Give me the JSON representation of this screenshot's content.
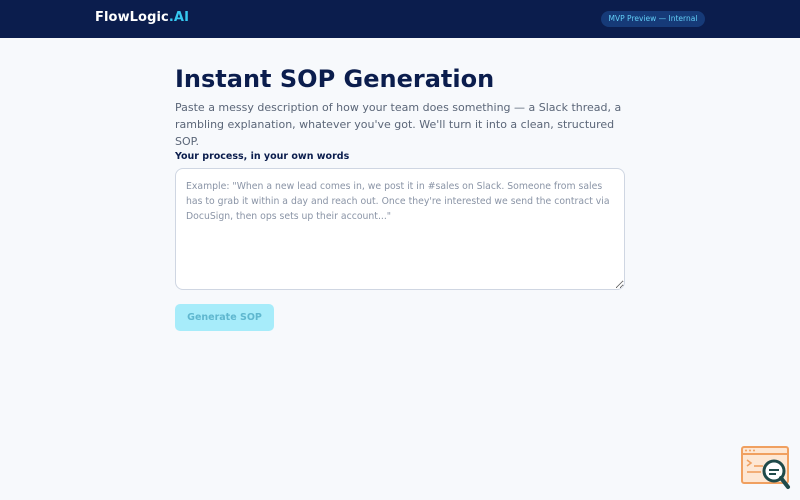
{
  "header": {
    "logo_main": "FlowLogic",
    "logo_accent": ".AI",
    "badge": "MVP Preview — Internal"
  },
  "main": {
    "title": "Instant SOP Generation",
    "subtitle": "Paste a messy description of how your team does something — a Slack thread, a rambling explanation, whatever you've got. We'll turn it into a clean, structured SOP.",
    "field_label": "Your process, in your own words",
    "process_value": "",
    "process_placeholder": "Example: \"When a new lead comes in, we post it in #sales on Slack. Someone from sales has to grab it within a day and reach out. Once they're interested we send the contract via DocuSign, then ops sets up their account...\"",
    "generate_label": "Generate SOP"
  },
  "colors": {
    "header_bg": "#0b1d4d",
    "accent": "#36c8f0",
    "button_disabled_bg": "#a7ecfa",
    "widget_orange": "#f0a060"
  },
  "icons": {
    "helper_widget": "search-document-icon"
  }
}
